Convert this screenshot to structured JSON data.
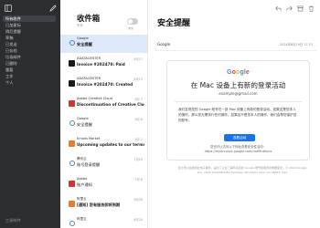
{
  "sidebar": {
    "icons": [
      "sidebar-toggle-icon",
      "compose-icon"
    ],
    "items": [
      {
        "label": "所有收件",
        "active": true
      },
      {
        "label": "已加星标",
        "active": false
      },
      {
        "label": "稍后提醒",
        "active": false
      },
      {
        "label": "草稿",
        "active": false
      },
      {
        "label": "已发送",
        "active": false
      },
      {
        "label": "已存档",
        "active": false
      },
      {
        "label": "垃圾邮件",
        "active": false
      },
      {
        "label": "已删除",
        "active": false
      },
      {
        "label": "重要",
        "active": false
      },
      {
        "label": "工作",
        "active": false
      },
      {
        "label": "个人",
        "active": false
      }
    ],
    "footer": "三星邮件"
  },
  "list": {
    "title": "收件箱",
    "subtitle": "所有",
    "toggle_label": "未读",
    "rows": [
      {
        "sender": "Google",
        "date": "",
        "subject": "安全提醒",
        "preview": "",
        "selected": true
      },
      {
        "sender": "ADATACENTER",
        "date": "8月17",
        "subject": "Invoice #202470: Paid",
        "preview": "",
        "selected": false
      },
      {
        "sender": "ADATACENTER",
        "date": "8月15",
        "subject": "Invoice #202470: Created",
        "preview": "",
        "selected": false
      },
      {
        "sender": "Adobe Creative Cloud",
        "date": "8月 7",
        "subject": "Discontinuation of Creative Cloud...",
        "preview": "",
        "selected": false
      },
      {
        "sender": "Google",
        "date": "8月 6",
        "subject": "安全提醒",
        "preview": "",
        "selected": false
      },
      {
        "sender": "Emails Market",
        "date": "8月 2",
        "subject": "Upcoming updates to our terms &...",
        "preview": "",
        "selected": false
      },
      {
        "sender": "腾讯云",
        "date": "7月29",
        "subject": "账号登录提醒",
        "preview": "",
        "selected": false
      },
      {
        "sender": "Adobe",
        "date": "7月 8",
        "subject": "账户通知",
        "preview": "",
        "selected": false
      },
      {
        "sender": "阿里云",
        "date": "6月28",
        "subject": "[通知] 您有服务即将到期",
        "preview": "",
        "selected": false
      },
      {
        "sender": "阿里云",
        "date": "6月24",
        "subject": "账号安全提醒",
        "preview": "",
        "selected": false
      },
      {
        "sender": "",
        "date": "6月22",
        "subject": "",
        "preview": "",
        "selected": false
      }
    ]
  },
  "detail": {
    "title": "安全提醒",
    "from": "Google",
    "date": "2024年8月19日 17:15",
    "card": {
      "logo": "Google",
      "title": "在 Mac 设备上有新的登录活动",
      "account": "example@gmail.com",
      "body": "我们发现您的 Google 账号在一部 Mac 设备上有新的登录活动。如果这是您本人的操作，那么您无需执行任何操作。如果这不是您本人的操作，我们会帮您保护您的账号。",
      "button": "查看活动",
      "footer": "您也可以访问以下网址查看安全性活动：https://myaccount.google.com/notifications"
    },
    "legal": "您之所以会收到此电子邮件，是为了让您了解有关您的 Google 账号和服务的重要变化。© 2024 Google LLC, 1600 Amphitheatre Parkway, Mountain View, CA 94043, USA"
  },
  "colors": {
    "sidebar_bg": "#2b2d31",
    "selected_row": "#dde9fb",
    "accent": "#1a73e8"
  }
}
